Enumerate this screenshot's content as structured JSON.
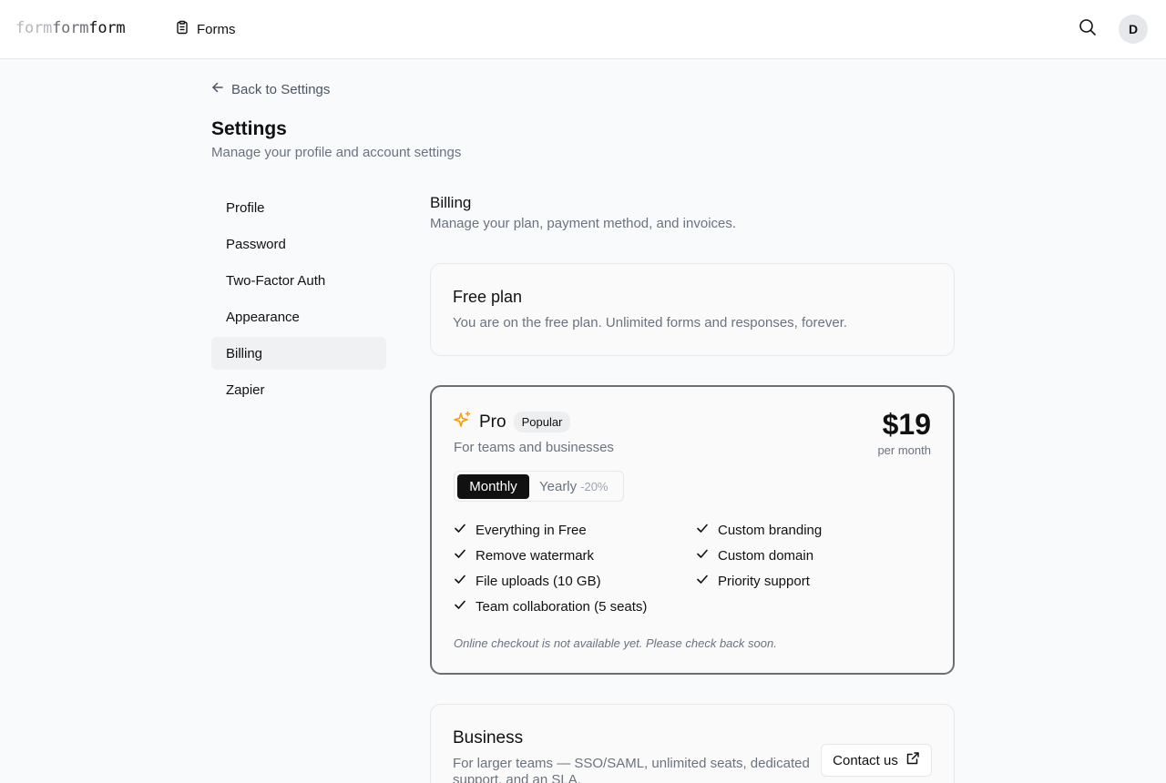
{
  "topbar": {
    "logo": {
      "part1": "form",
      "part2": "form",
      "part3": "form"
    },
    "nav_forms_label": "Forms",
    "forms_icon": "clipboard-icon",
    "search_icon": "search-icon",
    "avatar_initial": "D"
  },
  "header": {
    "back_label": "Back to Settings",
    "title": "Settings",
    "subtitle": "Manage your profile and account settings"
  },
  "sidebar": {
    "items": [
      {
        "label": "Profile"
      },
      {
        "label": "Password"
      },
      {
        "label": "Two-Factor Auth"
      },
      {
        "label": "Appearance"
      },
      {
        "label": "Billing",
        "active": true
      },
      {
        "label": "Zapier"
      }
    ]
  },
  "billing": {
    "title": "Billing",
    "subtitle": "Manage your plan, payment method, and invoices.",
    "free_plan": {
      "title": "Free plan",
      "description": "You are on the free plan. Unlimited forms and responses, forever."
    },
    "pro_plan": {
      "icon": "sparkles-icon",
      "icon_color": "#f59e0b",
      "name": "Pro",
      "badge": "Popular",
      "description": "For teams and businesses",
      "price": "$19",
      "period": "per month",
      "toggle": {
        "monthly": "Monthly",
        "yearly": "Yearly",
        "yearly_discount": "-20%",
        "selected": "Monthly"
      },
      "features_left": [
        "Everything in Free",
        "Remove watermark",
        "File uploads (10 GB)",
        "Team collaboration (5 seats)"
      ],
      "features_right": [
        "Custom branding",
        "Custom domain",
        "Priority support"
      ],
      "note": "Online checkout is not available yet. Please check back soon."
    },
    "business_plan": {
      "title": "Business",
      "description": "For larger teams — SSO/SAML, unlimited seats, dedicated support, and an SLA.",
      "button_label": "Contact us",
      "button_icon": "external-link-icon"
    }
  }
}
